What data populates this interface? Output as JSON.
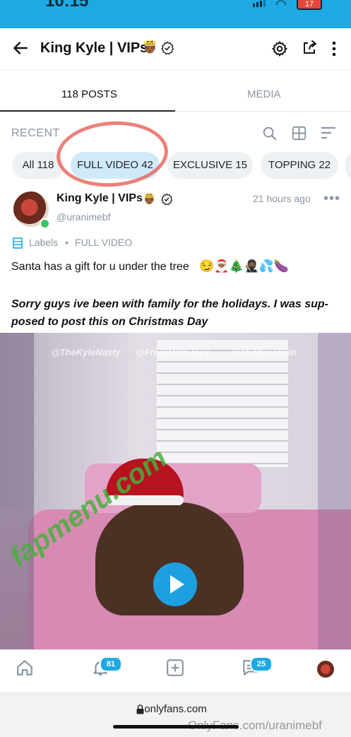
{
  "status_bar": {
    "time": "10:15",
    "battery": "17"
  },
  "header": {
    "title": "King Kyle | VIPs",
    "title_emoji": "🤴🏾"
  },
  "tabs": [
    {
      "label": "118 POSTS",
      "active": true
    },
    {
      "label": "MEDIA",
      "active": false
    }
  ],
  "recent": {
    "label": "RECENT",
    "chips": [
      {
        "label": "All 118"
      },
      {
        "label": "FULL VIDEO 42",
        "active": true
      },
      {
        "label": "EXCLUSIVE 15"
      },
      {
        "label": "TOPPING 22"
      }
    ]
  },
  "post": {
    "author": "King Kyle | VIPs",
    "author_emoji": "🤴🏾",
    "handle": "@uranimebf",
    "time": "21 hours ago",
    "more": "•••",
    "labels_label": "Labels",
    "label_separator": "•",
    "label_value": "FULL VIDEO",
    "text_line1": "Santa has a gift for u under the tree",
    "text_emojis": "😏🎅🏾🎄🥷🏾💦🍆",
    "text_line2": "Sorry guys ive been with family for the holidays. I was sup-posed to post this on Christmas Day",
    "media_watermarks": [
      "@TheKyleNasty",
      "@FreakWithJayy",
      "@MxMunchkin"
    ]
  },
  "bottom_nav": {
    "notifications_badge": "81",
    "messages_badge": "25"
  },
  "overlays": {
    "site_watermark": "fapmenu.com",
    "of_watermark": "OnlyFans.com/uranimebf"
  },
  "browser": {
    "url": "onlyfans.com"
  },
  "colors": {
    "accent": "#1ea9e4",
    "muted": "#8a96a3",
    "chip_active": "#cfeaf8",
    "annotation_circle": "#e86058"
  }
}
